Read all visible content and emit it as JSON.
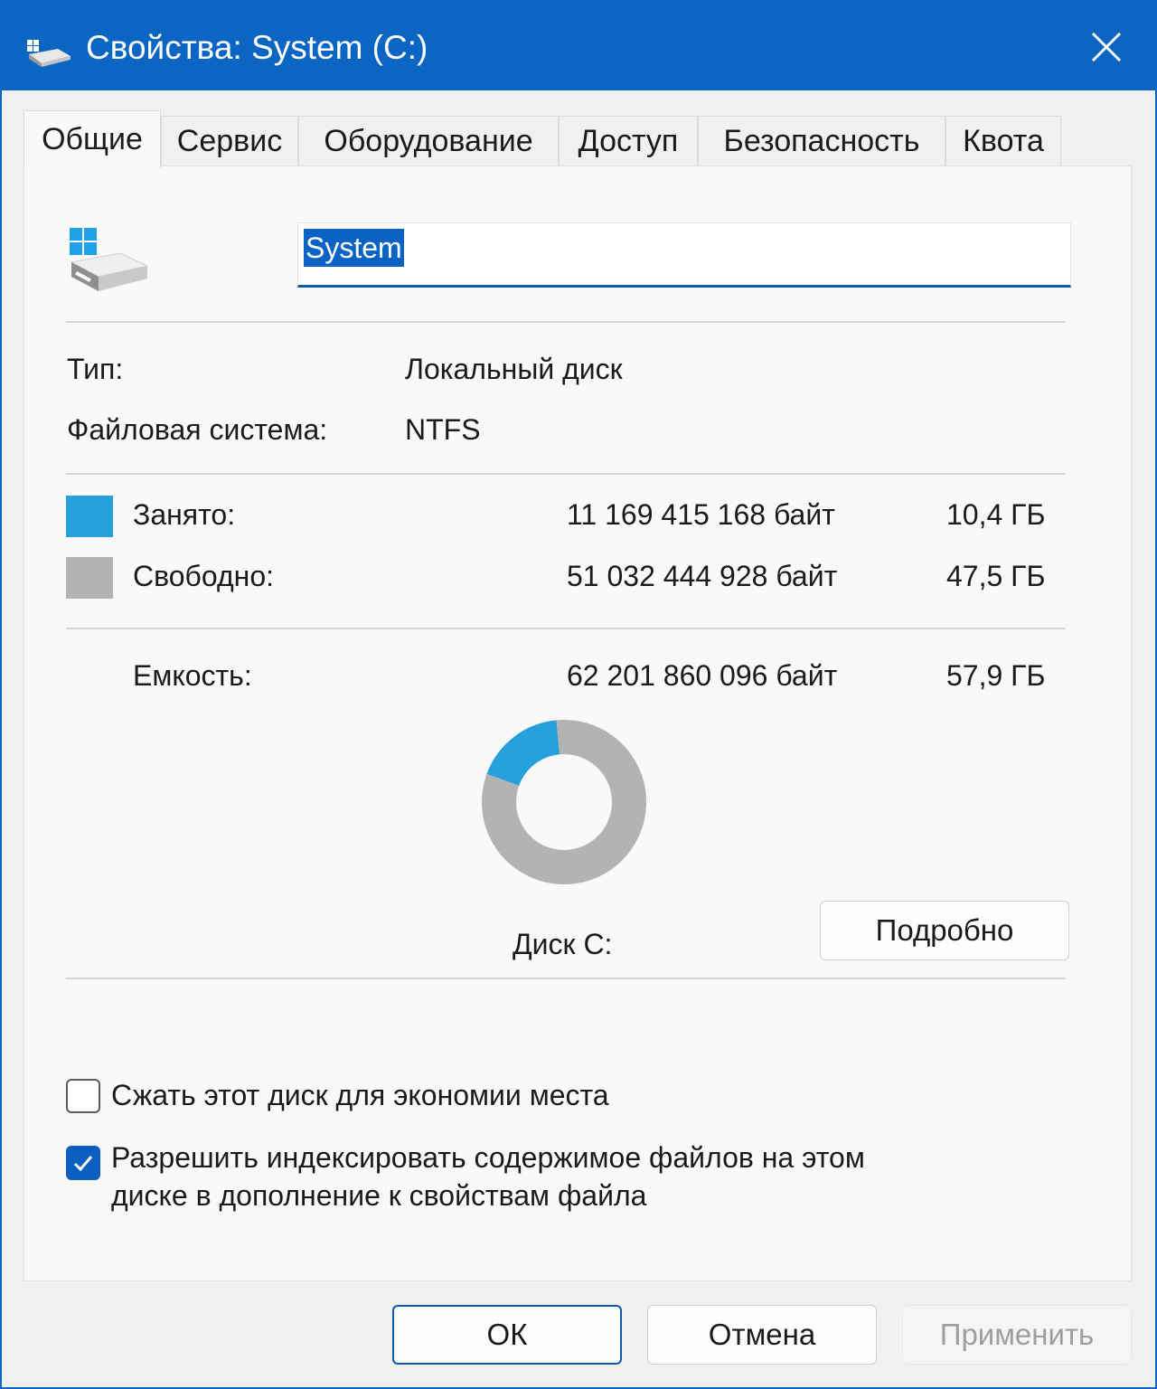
{
  "window": {
    "title": "Свойства: System (C:)",
    "icon": "drive-icon",
    "close_icon": "close-icon",
    "title_bar_color": "#0b66c3"
  },
  "tabs": [
    {
      "label": "Общие",
      "active": true
    },
    {
      "label": "Сервис",
      "active": false
    },
    {
      "label": "Оборудование",
      "active": false
    },
    {
      "label": "Доступ",
      "active": false
    },
    {
      "label": "Безопасность",
      "active": false
    },
    {
      "label": "Квота",
      "active": false
    }
  ],
  "general": {
    "drive_icon": "windows-drive-icon",
    "volume_name": "System",
    "type_label": "Тип:",
    "type_value": "Локальный диск",
    "fs_label": "Файловая система:",
    "fs_value": "NTFS",
    "used": {
      "label": "Занято:",
      "bytes": "11 169 415 168 байт",
      "size": "10,4 ГБ",
      "color": "#26a0da"
    },
    "free": {
      "label": "Свободно:",
      "bytes": "51 032 444 928 байт",
      "size": "47,5 ГБ",
      "color": "#b3b3b3"
    },
    "capacity": {
      "label": "Емкость:",
      "bytes": "62 201 860 096 байт",
      "size": "57,9 ГБ"
    },
    "drive_label": "Диск C:",
    "details_button": "Подробно",
    "compress_label": "Сжать этот диск для экономии места",
    "compress_checked": false,
    "index_label_line1": "Разрешить индексировать содержимое файлов на этом",
    "index_label_line2": "диске в дополнение к свойствам файла",
    "index_checked": true
  },
  "chart_data": {
    "type": "pie",
    "categories": [
      "Занято",
      "Свободно"
    ],
    "values": [
      10.4,
      47.5
    ],
    "colors": [
      "#26a0da",
      "#b3b3b3"
    ],
    "title": "Диск C:"
  },
  "buttons": {
    "ok": "ОК",
    "cancel": "Отмена",
    "apply": "Применить",
    "apply_enabled": false
  }
}
